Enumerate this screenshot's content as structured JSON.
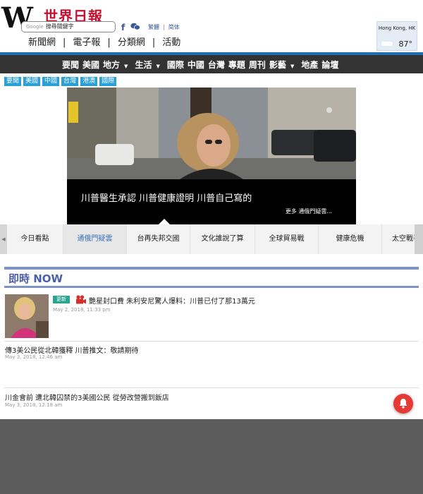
{
  "header": {
    "logo_letter": "W",
    "logo_name": "世界日報",
    "search_prefix": "Google",
    "search_placeholder": "搜尋關鍵字",
    "lang_traditional": "繁體",
    "lang_simplified": "简体",
    "nav": [
      "新聞網",
      "電子報",
      "分類網",
      "活動"
    ]
  },
  "weather": {
    "city": "Hong Kong, HK",
    "temp": "87°",
    "icon": "partly-cloudy-icon"
  },
  "main_nav": [
    "要聞",
    "美國",
    "地方",
    "生活",
    "國際",
    "中國",
    "台灣",
    "專題",
    "周刊",
    "影藝",
    "地產",
    "論壇"
  ],
  "main_nav_dropdowns": [
    "地方",
    "生活",
    "影藝"
  ],
  "sub_tags": [
    "要聞",
    "美國",
    "中國",
    "台灣",
    "港澳",
    "國際"
  ],
  "hero": {
    "caption": "川普醫生承認 川普健康證明 川普自己寫的",
    "more": "更多 通俄門疑雲..."
  },
  "topics": {
    "items": [
      "今日看點",
      "通俄門疑雲",
      "台再失邦交國",
      "文化誰說了算",
      "全球貿易戰",
      "健康危機",
      "太空戰爭"
    ],
    "active": "通俄門疑雲"
  },
  "now_section": {
    "title": "即時 NOW",
    "items": [
      {
        "tag": "更新",
        "has_video": true,
        "title": "艷星封口費 朱利安尼驚人爆料：川普已付了那13萬元",
        "time": "May 2, 2018, 11:33 pm"
      },
      {
        "title": "傳3美公民從北韓獲釋 川普推文：敬請期待",
        "time": "May 3, 2018, 12:46 am"
      },
      {
        "title": "川金會前 遭北韓囚禁的3美國公民 從勞改營搬到飯店",
        "time": "May 3, 2018, 12:18 am"
      }
    ]
  },
  "colors": {
    "brand_red": "#c8102e",
    "nav_blue": "#1e6fb5",
    "tag_blue": "#2aa0d7",
    "now_blue": "#4a5fa8"
  }
}
